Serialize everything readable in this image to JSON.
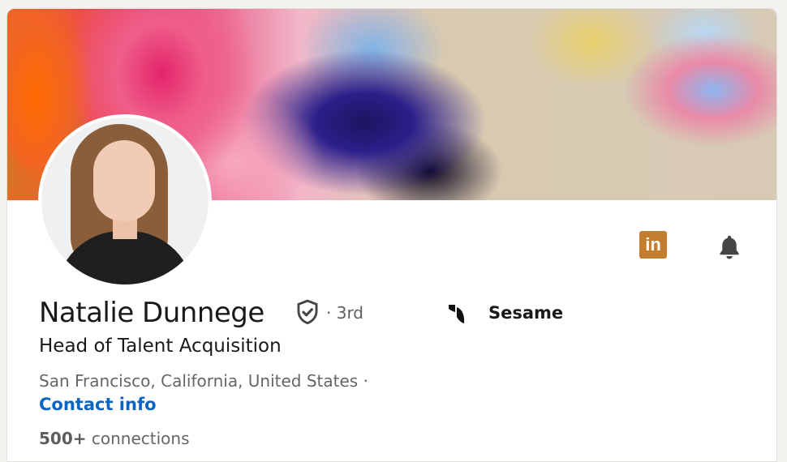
{
  "profile": {
    "name": "Natalie Dunnege",
    "degree": "· 3rd",
    "headline": "Head of Talent Acquisition",
    "location": "San Francisco, California, United States ·",
    "contact_info": "Contact info",
    "connections_count": "500+",
    "connections_label": "connections"
  },
  "company": {
    "name": "Sesame"
  },
  "icons": {
    "linkedin": "linkedin-icon",
    "notifications": "bell-icon",
    "verified": "verified-shield-icon",
    "company_logo": "sesame-logo-icon"
  },
  "colors": {
    "linkedin_badge": "#c37d2f",
    "link_blue": "#0a66c2",
    "text_primary": "#191919",
    "text_secondary": "#666666"
  }
}
